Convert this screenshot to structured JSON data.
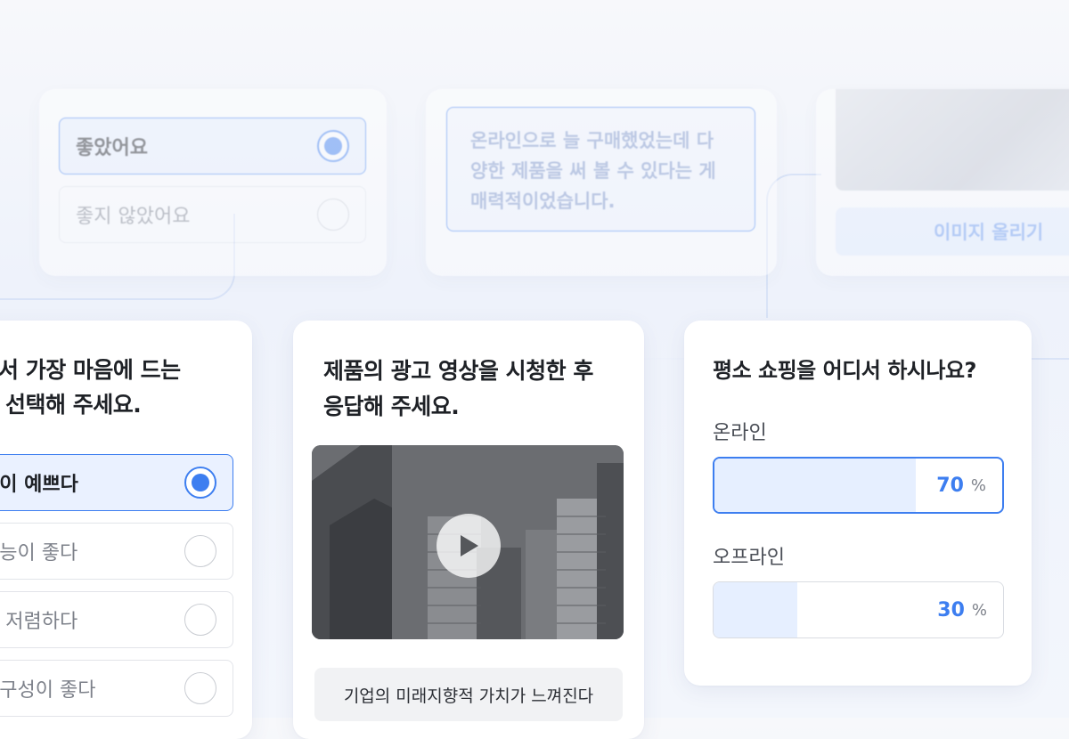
{
  "background_cards": {
    "satisfaction": {
      "options": [
        {
          "label": "좋았어요",
          "selected": true
        },
        {
          "label": "좋지 않았어요",
          "selected": false
        }
      ]
    },
    "text_answer": {
      "value": "온라인으로 늘 구매했었는데 다양한 제품을 써 볼 수 있다는 게 매력적이었습니다."
    },
    "image_upload": {
      "button_label": "이미지 올리기"
    }
  },
  "design_card": {
    "question_line1": "서 가장 마음에 드는",
    "question_line2": "선택해 주세요.",
    "options": [
      {
        "label": "인이 예쁘다",
        "selected": true
      },
      {
        "label": "성능이 좋다",
        "selected": false
      },
      {
        "label": "이 저렴하다",
        "selected": false
      },
      {
        "label": "내구성이 좋다",
        "selected": false
      }
    ]
  },
  "video_card": {
    "question_line1": "제품의 광고 영상을 시청한 후",
    "question_line2": "응답해 주세요.",
    "play_icon": "play-icon",
    "answer_option": "기업의 미래지향적 가치가 느껴진다"
  },
  "shopping_card": {
    "question": "평소 쇼핑을 어디서 하시나요?",
    "results": [
      {
        "label": "온라인",
        "percent": 70,
        "unit": "%"
      },
      {
        "label": "오프라인",
        "percent": 30,
        "unit": "%"
      }
    ]
  },
  "colors": {
    "accent": "#3d7ef0",
    "accent_light": "#e6efff",
    "text_dark": "#1e2126",
    "text_muted": "#7d818a"
  }
}
